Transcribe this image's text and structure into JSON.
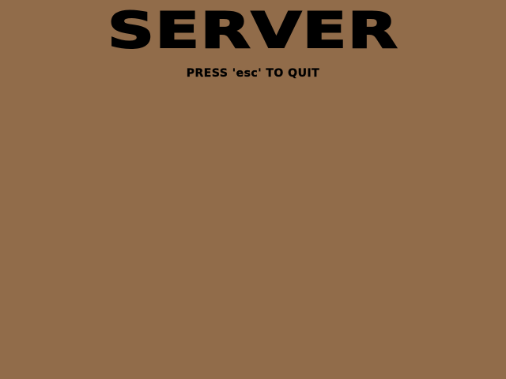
{
  "screen": {
    "title": "SERVER",
    "instruction": "PRESS 'esc' TO QUIT"
  },
  "colors": {
    "background": "#916c4a",
    "text": "#000000"
  }
}
